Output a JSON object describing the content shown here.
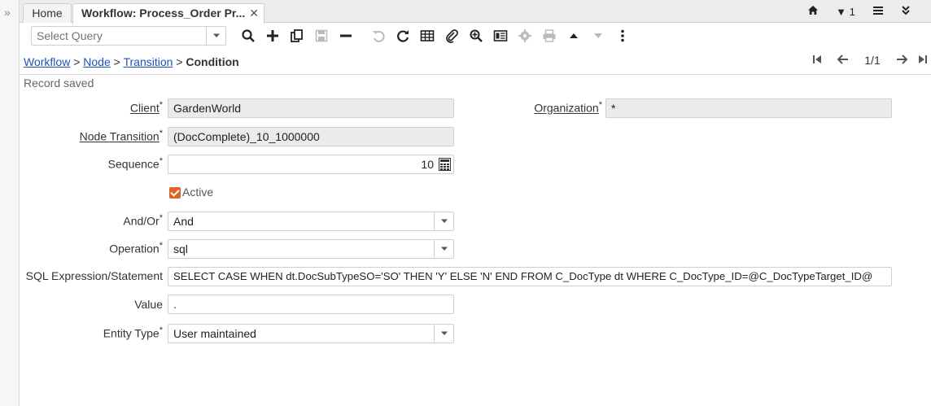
{
  "tabs": {
    "home_label": "Home",
    "active_label": "Workflow: Process_Order Pr...",
    "close_glyph": "✕",
    "window_count": "1"
  },
  "toolbar": {
    "query_placeholder": "Select Query"
  },
  "breadcrumb": {
    "items": [
      "Workflow",
      "Node",
      "Transition"
    ],
    "separator": ">",
    "current": "Condition"
  },
  "navigation": {
    "record_position": "1/1"
  },
  "status": {
    "message": "Record saved"
  },
  "form": {
    "client": {
      "label": "Client",
      "value": "GardenWorld"
    },
    "organization": {
      "label": "Organization",
      "value": "*"
    },
    "node_transition": {
      "label": "Node Transition",
      "value": "(DocComplete)_10_1000000"
    },
    "sequence": {
      "label": "Sequence",
      "value": "10"
    },
    "active": {
      "label": "Active",
      "checked": true
    },
    "and_or": {
      "label": "And/Or",
      "value": "And"
    },
    "operation": {
      "label": "Operation",
      "value": "sql"
    },
    "sql_expression": {
      "label": "SQL Expression/Statement",
      "value": "SELECT CASE WHEN dt.DocSubTypeSO='SO' THEN 'Y' ELSE 'N' END FROM C_DocType dt WHERE C_DocType_ID=@C_DocTypeTarget_ID@"
    },
    "value": {
      "label": "Value",
      "value": "."
    },
    "entity_type": {
      "label": "Entity Type",
      "value": "User maintained"
    },
    "required_mark": "*"
  },
  "colors": {
    "link": "#1a53b8",
    "accent_checkbox": "#e0642a",
    "readonly_bg": "#ebebeb"
  }
}
